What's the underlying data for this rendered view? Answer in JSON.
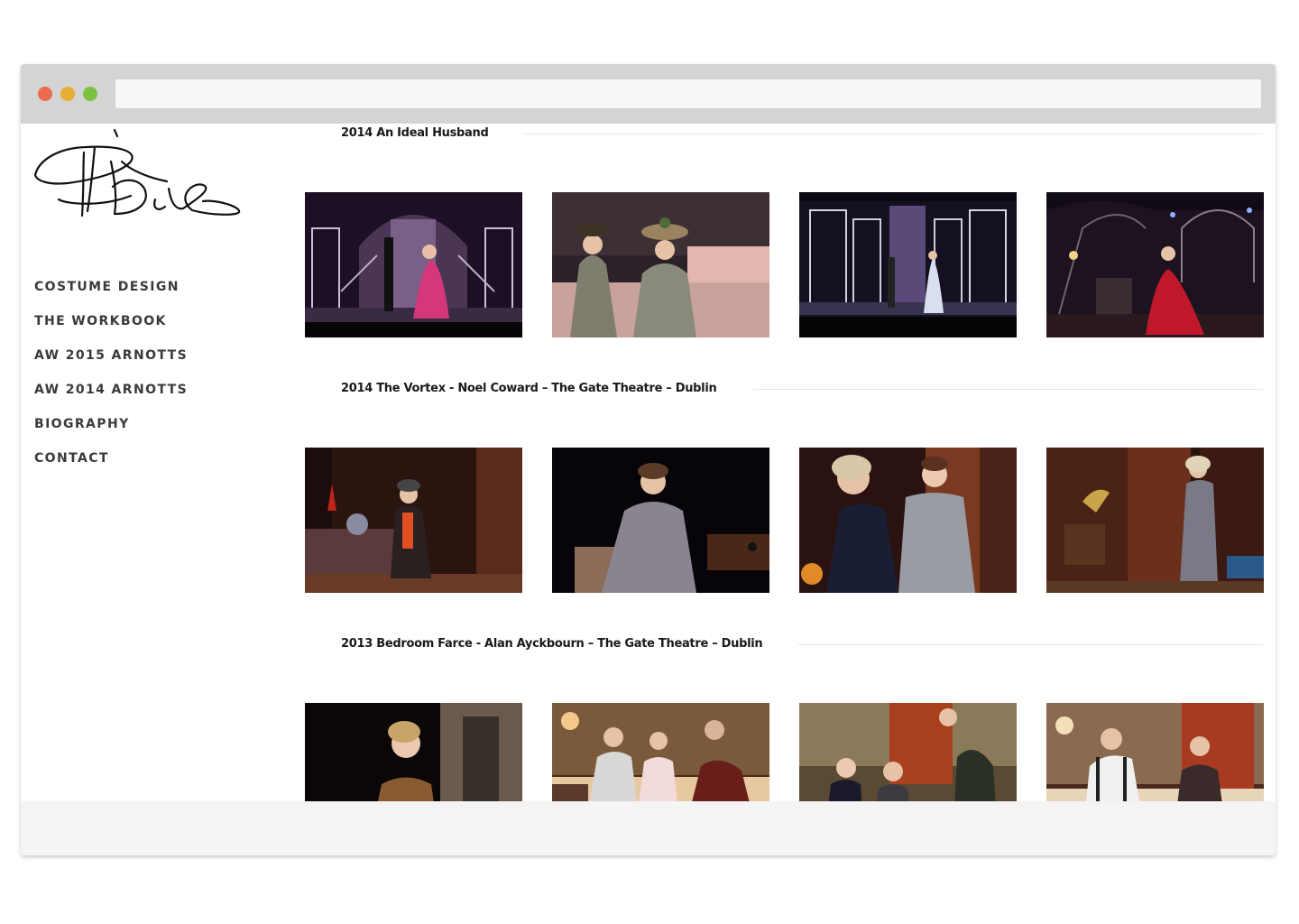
{
  "browser": {
    "url": ""
  },
  "sidebar": {
    "logo_alt": "PB",
    "nav": [
      {
        "label": "COSTUME DESIGN"
      },
      {
        "label": "THE WORKBOOK"
      },
      {
        "label": "AW 2015 ARNOTTS"
      },
      {
        "label": "AW 2014 ARNOTTS"
      },
      {
        "label": "BIOGRAPHY"
      },
      {
        "label": "CONTACT"
      }
    ]
  },
  "sections": [
    {
      "title": "2014 An Ideal Husband"
    },
    {
      "title": "2014 The Vortex - Noel Coward – The Gate Theatre – Dublin"
    },
    {
      "title": "2013 Bedroom Farce - Alan Ayckbourn – The Gate Theatre – Dublin"
    }
  ],
  "colors": {
    "titlebar": "#d4d4d4",
    "close": "#ec6a4d",
    "minimize": "#e7ae36",
    "maximize": "#7ac142"
  }
}
